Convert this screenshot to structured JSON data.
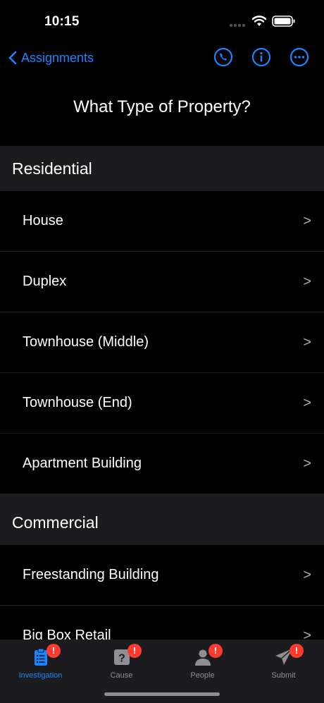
{
  "status_bar": {
    "time": "10:15"
  },
  "nav": {
    "back_label": "Assignments",
    "icons": [
      "phone-icon",
      "info-icon",
      "more-icon"
    ]
  },
  "title": "What Type of Property?",
  "sections": [
    {
      "header": "Residential",
      "items": [
        "House",
        "Duplex",
        "Townhouse (Middle)",
        "Townhouse (End)",
        "Apartment Building"
      ]
    },
    {
      "header": "Commercial",
      "items": [
        "Freestanding Building",
        "Big Box Retail"
      ]
    }
  ],
  "chevron": ">",
  "tabs": [
    {
      "label": "Investigation",
      "icon": "clipboard-icon",
      "badge": "!",
      "active": true
    },
    {
      "label": "Cause",
      "icon": "question-icon",
      "badge": "!",
      "active": false
    },
    {
      "label": "People",
      "icon": "person-icon",
      "badge": "!",
      "active": false
    },
    {
      "label": "Submit",
      "icon": "send-icon",
      "badge": "!",
      "active": false
    }
  ],
  "colors": {
    "accent": "#1a84ff",
    "badge": "#ff3b30",
    "background": "#000000",
    "section": "#1c1c1e"
  }
}
